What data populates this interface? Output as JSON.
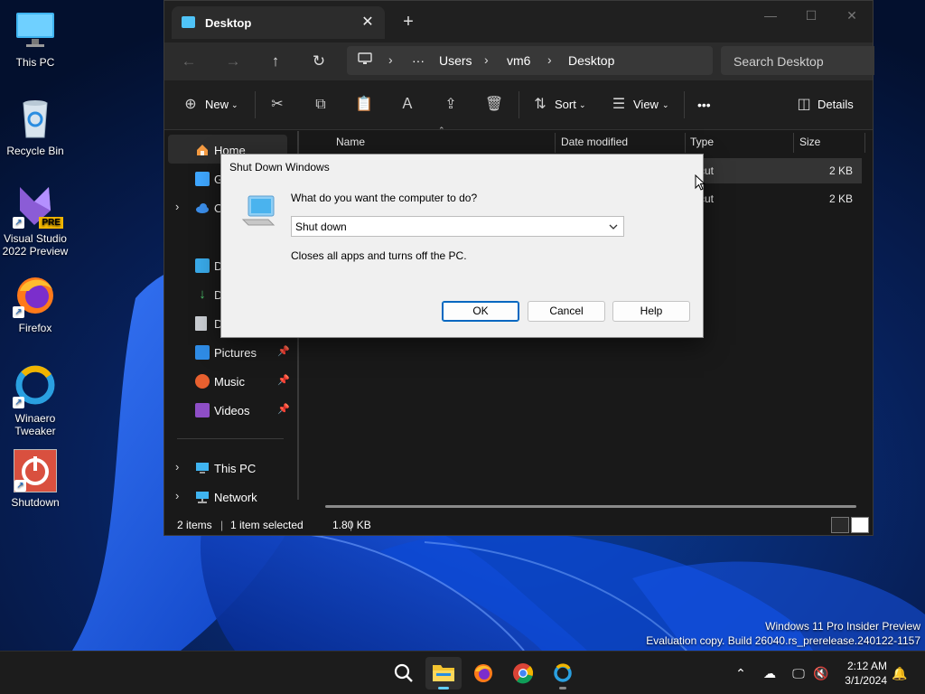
{
  "desktop": {
    "icons": [
      {
        "label": "This PC"
      },
      {
        "label": "Recycle Bin"
      },
      {
        "label": "Visual Studio 2022 Preview",
        "badge": "PRE"
      },
      {
        "label": "Firefox"
      },
      {
        "label": "Winaero Tweaker"
      },
      {
        "label": "Shutdown"
      }
    ]
  },
  "explorer": {
    "tab_title": "Desktop",
    "tab_close_icon": "close-icon",
    "new_tab_icon": "plus-icon",
    "window_controls": [
      "minimize",
      "maximize",
      "close"
    ],
    "address": {
      "crumbs": [
        "Users",
        "vm6",
        "Desktop"
      ],
      "overflow": "···"
    },
    "search_placeholder": "Search Desktop",
    "toolbar": {
      "new_label": "New",
      "sort_label": "Sort",
      "view_label": "View",
      "details_label": "Details",
      "more": "•••"
    },
    "nav": {
      "home": "Home",
      "gallery_partial": "G",
      "onedrive_partial": "O",
      "desktop_partial": "D",
      "downloads_partial": "D",
      "documents_partial": "D",
      "pictures": "Pictures",
      "music": "Music",
      "videos": "Videos",
      "this_pc": "This PC",
      "network": "Network"
    },
    "columns": {
      "name": "Name",
      "date_modified": "Date modified",
      "type": "Type",
      "size": "Size"
    },
    "files": [
      {
        "type": "ortcut",
        "size": "2 KB"
      },
      {
        "type": "ortcut",
        "size": "2 KB"
      }
    ],
    "status": {
      "items": "2 items",
      "selected": "1 item selected",
      "size": "1.80 KB"
    }
  },
  "dialog": {
    "title": "Shut Down Windows",
    "question": "What do you want the computer to do?",
    "selected_option": "Shut down",
    "description": "Closes all apps and turns off the PC.",
    "ok": "OK",
    "cancel": "Cancel",
    "help": "Help"
  },
  "watermark": {
    "line1": "Windows 11 Pro Insider Preview",
    "line2": "Evaluation copy. Build 26040.rs_prerelease.240122-1157"
  },
  "taskbar": {
    "time": "2:12 AM",
    "date": "3/1/2024"
  },
  "colors": {
    "accent": "#60cdff",
    "dialog_default_border": "#0067c0",
    "explorer_bg": "#191919"
  }
}
